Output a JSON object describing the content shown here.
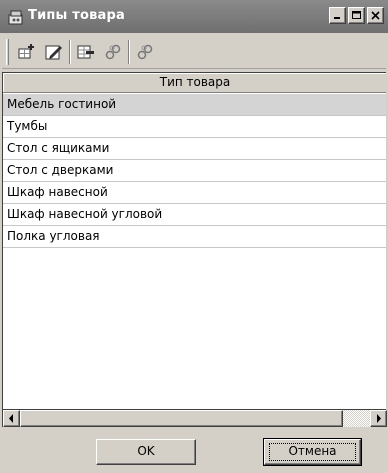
{
  "window": {
    "title": "Типы товара",
    "icon": "app-icon",
    "controls": [
      "minimize-icon",
      "maximize-icon",
      "close-icon"
    ]
  },
  "toolbar": {
    "buttons": [
      {
        "name": "add-icon"
      },
      {
        "name": "edit-icon"
      },
      {
        "name": "delete-icon"
      },
      {
        "name": "link-icon"
      },
      {
        "name": "unlink-icon"
      }
    ]
  },
  "grid": {
    "column_header": "Тип товара",
    "rows": [
      "Мебель гостиной",
      "Тумбы",
      "Стол с ящиками",
      "Стол с дверками",
      "Шкаф навесной",
      "Шкаф навесной угловой",
      "Полка угловая"
    ],
    "selected_index": 0
  },
  "buttons": {
    "ok_label": "OK",
    "cancel_label": "Отмена"
  },
  "colors": {
    "title_bar": "#7a7a7a",
    "face": "#d4d0c8",
    "selected_row": "#d4d4d4"
  }
}
